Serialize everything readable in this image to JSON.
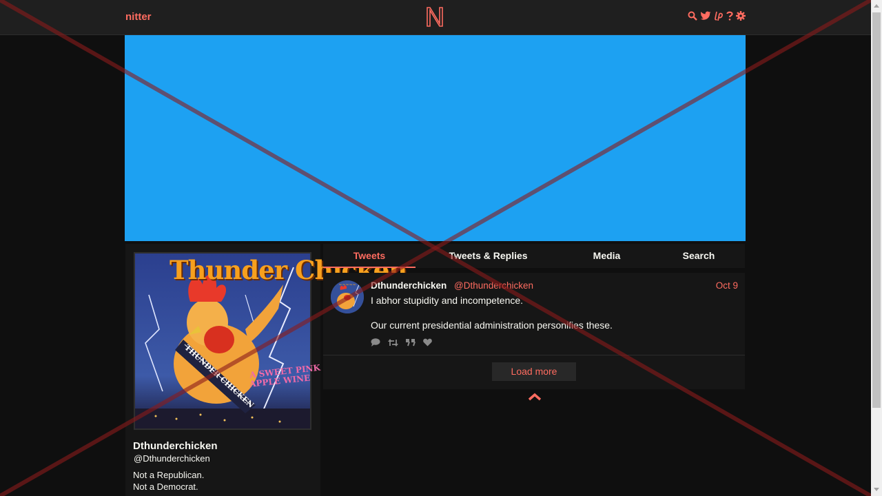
{
  "nav": {
    "brand": "nitter",
    "icons": [
      "search-icon",
      "twitter-bird-icon",
      "liberapay-icon",
      "help-icon",
      "settings-gear-icon"
    ]
  },
  "colors": {
    "accent": "#ff6c60",
    "background": "#0f0f0f",
    "panel": "#161616",
    "navbar": "#1f1f1f",
    "banner": "#1da1f2"
  },
  "profile": {
    "fullname": "Dthunderchicken",
    "username": "@Dthunderchicken",
    "bio_lines": [
      "Not a Republican.",
      "Not a Democrat."
    ],
    "avatar_texts": {
      "title": "Thunder Chicken",
      "sash": "THUNDER CHICKEN",
      "tagline_1": "A SWEET PINK",
      "tagline_2": "APPLE WINE"
    }
  },
  "tabs": [
    {
      "label": "Tweets",
      "active": true
    },
    {
      "label": "Tweets & Replies",
      "active": false
    },
    {
      "label": "Media",
      "active": false
    },
    {
      "label": "Search",
      "active": false
    }
  ],
  "tweet": {
    "fullname": "Dthunderchicken",
    "username": "@Dthunderchicken",
    "date": "Oct 9",
    "paragraphs": [
      "I abhor stupidity and incompetence.",
      "Our current presidential administration personifies these."
    ],
    "stat_icons": [
      "comment-icon",
      "retweet-icon",
      "quote-icon",
      "heart-icon"
    ]
  },
  "load_more": "Load more"
}
